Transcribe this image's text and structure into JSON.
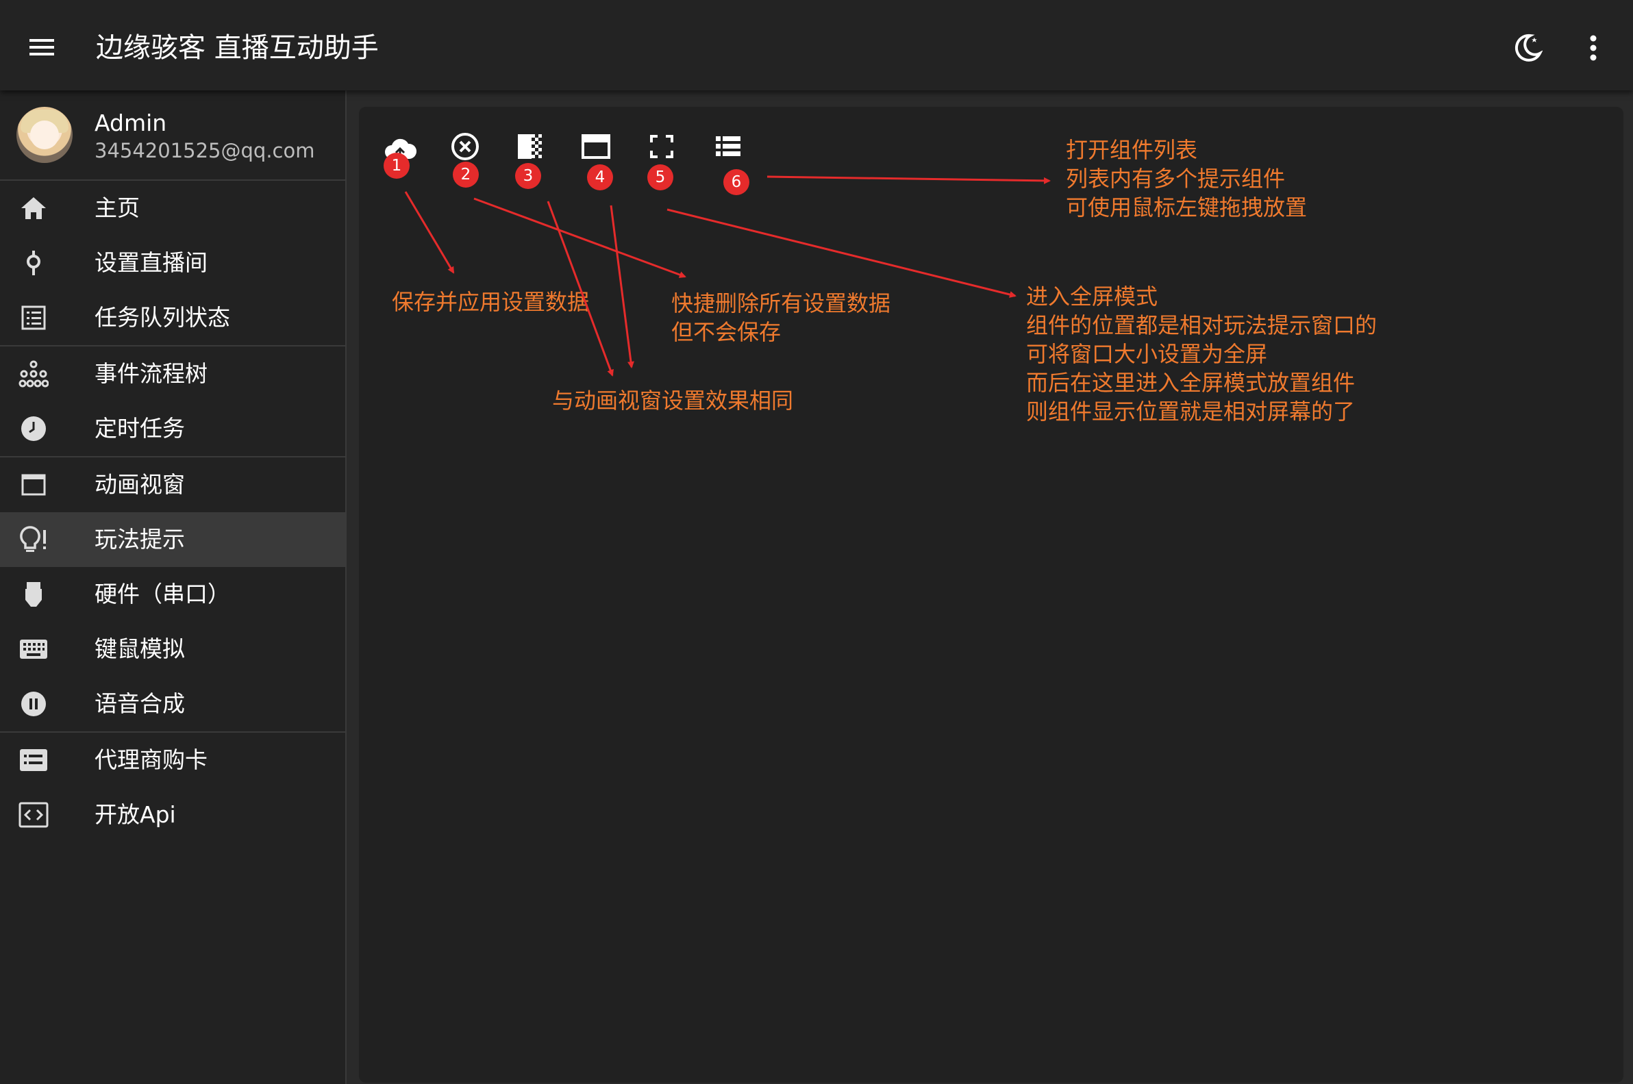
{
  "app": {
    "title": "边缘骇客 直播互动助手"
  },
  "topbar": {
    "menu_icon": "menu-icon",
    "theme_icon": "dark-mode-icon",
    "more_icon": "more-vert-icon"
  },
  "profile": {
    "name": "Admin",
    "email": "3454201525@qq.com"
  },
  "sidebar": {
    "items": [
      {
        "label": "主页",
        "icon": "home-icon"
      },
      {
        "label": "设置直播间",
        "icon": "pin-icon"
      },
      {
        "label": "任务队列状态",
        "icon": "list-alt-icon"
      },
      {
        "label": "事件流程树",
        "icon": "tree-icon"
      },
      {
        "label": "定时任务",
        "icon": "clock-icon"
      },
      {
        "label": "动画视窗",
        "icon": "window-icon"
      },
      {
        "label": "玩法提示",
        "icon": "lightbulb-icon",
        "active": true
      },
      {
        "label": "硬件（串口）",
        "icon": "usb-plug-icon"
      },
      {
        "label": "键鼠模拟",
        "icon": "keyboard-icon"
      },
      {
        "label": "语音合成",
        "icon": "pause-circle-icon"
      },
      {
        "label": "代理商购卡",
        "icon": "card-list-icon"
      },
      {
        "label": "开放Api",
        "icon": "code-icon"
      }
    ]
  },
  "toolbar": {
    "badges": [
      "1",
      "2",
      "3",
      "4",
      "5",
      "6"
    ],
    "icons": [
      "cloud-upload-icon",
      "cancel-circle-icon",
      "opacity-icon",
      "window-toggle-icon",
      "fullscreen-icon",
      "component-list-icon"
    ]
  },
  "annotations": {
    "component_list": [
      "打开组件列表",
      "列表内有多个提示组件",
      "可使用鼠标左键拖拽放置"
    ],
    "save_apply": "保存并应用设置数据",
    "delete_all": [
      "快捷删除所有设置数据",
      "但不会保存"
    ],
    "same_as_animation": "与动画视窗设置效果相同",
    "fullscreen": [
      "进入全屏模式",
      "组件的位置都是相对玩法提示窗口的",
      "可将窗口大小设置为全屏",
      "而后在这里进入全屏模式放置组件",
      "则组件显示位置就是相对屏幕的了"
    ]
  },
  "colors": {
    "annotation": "#f07a2e",
    "badge": "#e52b2b",
    "arrow": "#e52b2b",
    "active_item": "#3a3a3a"
  }
}
